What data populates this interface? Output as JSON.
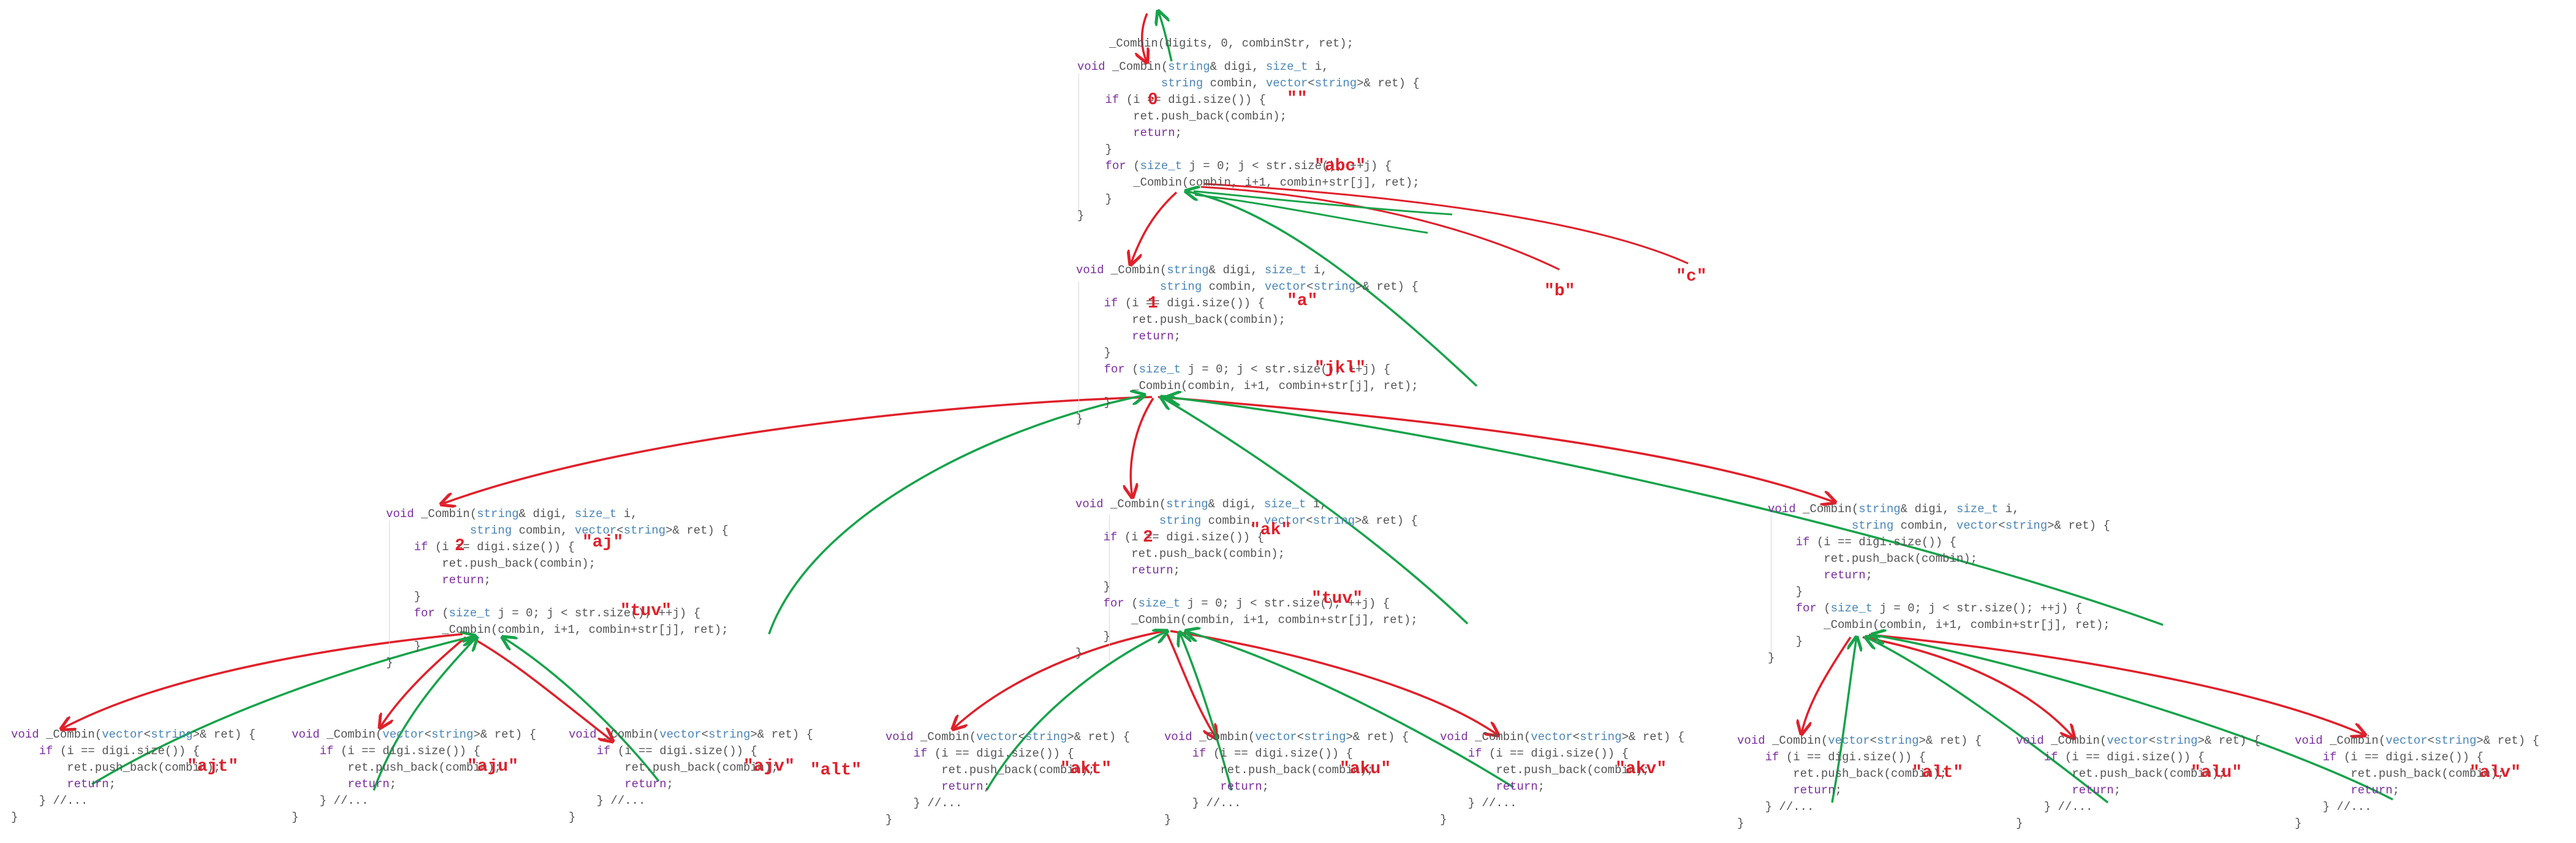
{
  "diagram": {
    "top_call": "_Combin(digits, 0, combinStr, ret);",
    "snippets": {
      "full": [
        "void _Combin(string& digi, size_t i,",
        "            string combin, vector<string>& ret) {",
        "    if (i == digi.size()) {",
        "        ret.push_back(combin);",
        "        return;",
        "    }",
        "    for (size_t j = 0; j < str.size(); ++j) {",
        "        _Combin(combin, i+1, combin+str[j], ret);",
        "    }",
        "}"
      ],
      "leaf": [
        "void _Combin(vector<string>& ret) {",
        "    if (i == digi.size()) {",
        "        ret.push_back(combin);",
        "        return;",
        "    } //...",
        "}"
      ]
    },
    "annotations": {
      "level0_i": "0",
      "level0_combin": "\"\"",
      "level0_str": "\"abc\"",
      "level1_i": "1",
      "level1_combin": "\"a\"",
      "level1_str": "\"jkl\"",
      "branch_b": "\"b\"",
      "branch_c": "\"c\"",
      "level2_i": "2",
      "aj_combin": "\"aj\"",
      "aj_str": "\"tuv\"",
      "ak_combin": "\"ak\"",
      "ak_str": "\"tuv\"",
      "alt_side": "\"alt\"",
      "leaf_ajt": "\"ajt\"",
      "leaf_aju": "\"aju\"",
      "leaf_ajv": "\"ajv\"",
      "leaf_akt": "\"akt\"",
      "leaf_aku": "\"aku\"",
      "leaf_akv": "\"akv\"",
      "leaf_alt": "\"alt\"",
      "leaf_alu": "\"alu\"",
      "leaf_alv": "\"alv\""
    },
    "colors": {
      "call_arrow": "#e0202a",
      "return_arrow": "#17a34a",
      "keyword": "#7c2ea0",
      "type": "#4a86b8"
    }
  }
}
